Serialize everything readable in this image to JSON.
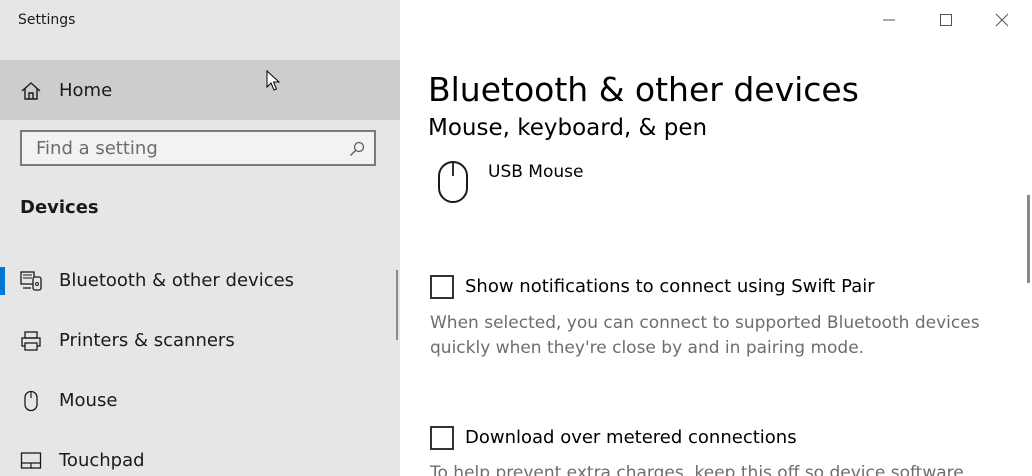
{
  "window": {
    "app_title": "Settings"
  },
  "sidebar": {
    "home_label": "Home",
    "search": {
      "placeholder": "Find a setting",
      "value": ""
    },
    "section_title": "Devices",
    "items": [
      {
        "label": "Bluetooth & other devices",
        "icon": "bluetooth-devices-icon",
        "selected": true
      },
      {
        "label": "Printers & scanners",
        "icon": "printer-icon",
        "selected": false
      },
      {
        "label": "Mouse",
        "icon": "mouse-icon",
        "selected": false
      },
      {
        "label": "Touchpad",
        "icon": "touchpad-icon",
        "selected": false
      }
    ]
  },
  "main": {
    "title": "Bluetooth & other devices",
    "subtitle": "Mouse, keyboard, & pen",
    "device": {
      "name": "USB Mouse",
      "icon": "mouse-icon"
    },
    "options": [
      {
        "label": "Show notifications to connect using Swift Pair",
        "checked": false,
        "description": "When selected, you can connect to supported Bluetooth devices quickly when they're close by and in pairing mode."
      },
      {
        "label": "Download over metered connections",
        "checked": false,
        "description": "To help prevent extra charges, keep this off so device software"
      }
    ]
  },
  "colors": {
    "accent": "#0078d7",
    "sidebar_bg": "#e6e6e6",
    "selected_bg": "#cdcdcd",
    "muted_text": "#6d6d6d"
  }
}
